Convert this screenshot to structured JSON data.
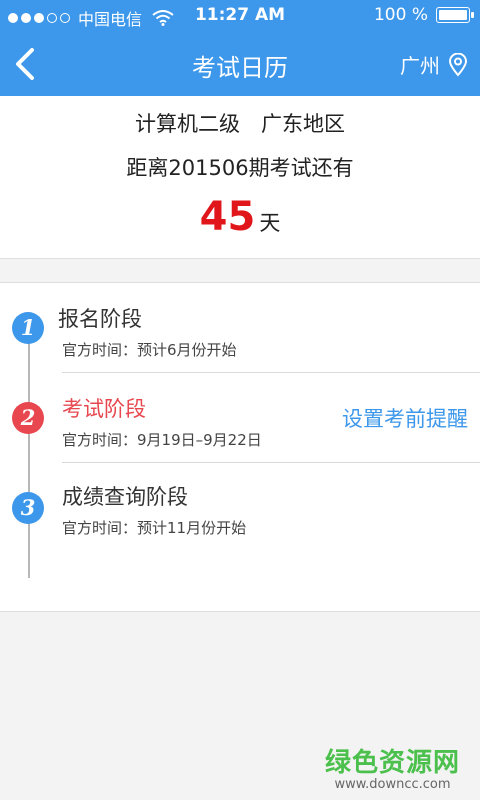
{
  "status_bar": {
    "carrier": "中国电信",
    "time": "11:27 AM",
    "battery": "100 %"
  },
  "nav": {
    "title": "考试日历",
    "city": "广州"
  },
  "summary": {
    "exam": "计算机二级　广东地区",
    "countdown_label": "距离201506期考试还有",
    "days": "45",
    "unit": "天"
  },
  "stages": [
    {
      "number": "1",
      "title": "报名阶段",
      "time": "官方时间：预计6月份开始",
      "color": "#3d97ea"
    },
    {
      "number": "2",
      "title": "考试阶段",
      "time": "官方时间：9月19日–9月22日",
      "color": "#e8474f"
    },
    {
      "number": "3",
      "title": "成绩查询阶段",
      "time": "官方时间：预计11月份开始",
      "color": "#3d97ea"
    }
  ],
  "remind_label": "设置考前提醒",
  "watermark": {
    "name": "绿色资源网",
    "url": "www.downcc.com"
  }
}
